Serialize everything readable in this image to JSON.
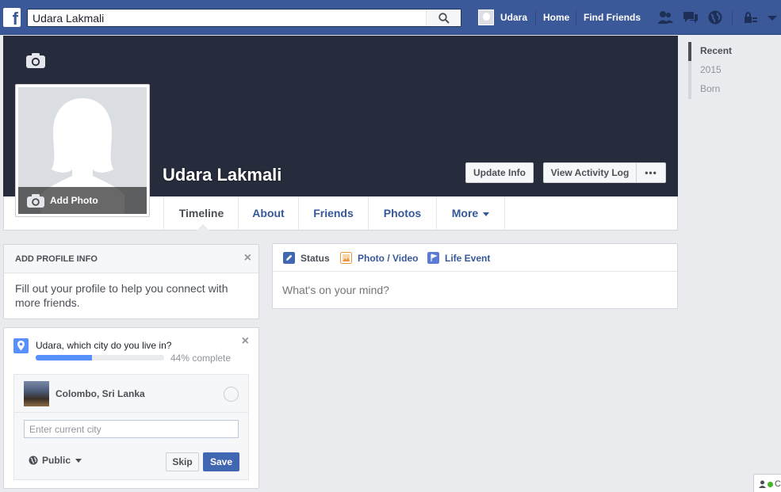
{
  "topbar": {
    "logo_letter": "f",
    "search_value": "Udara Lakmali",
    "user_name": "Udara",
    "home_label": "Home",
    "find_friends_label": "Find Friends"
  },
  "profile": {
    "name": "Udara Lakmali",
    "add_photo_label": "Add Photo",
    "update_info_label": "Update Info",
    "activity_log_label": "View Activity Log",
    "more_dots": "•••"
  },
  "tabs": [
    {
      "label": "Timeline"
    },
    {
      "label": "About"
    },
    {
      "label": "Friends"
    },
    {
      "label": "Photos"
    },
    {
      "label": "More"
    }
  ],
  "year_nav": [
    "Recent",
    "2015",
    "Born"
  ],
  "profile_info_card": {
    "header": "ADD PROFILE INFO",
    "close": "×",
    "body": "Fill out your profile to help you connect with more friends."
  },
  "city_card": {
    "question": "Udara, which city do you live in?",
    "progress_percent": 44,
    "progress_label": "44% complete",
    "close": "×",
    "suggested_city": "Colombo, Sri Lanka",
    "input_placeholder": "Enter current city",
    "privacy_label": "Public",
    "skip_label": "Skip",
    "save_label": "Save"
  },
  "composer": {
    "status_label": "Status",
    "photo_label": "Photo / Video",
    "life_event_label": "Life Event",
    "placeholder": "What's on your mind?"
  },
  "chat": {
    "label": "C"
  },
  "colors": {
    "brand_blue": "#3b5998",
    "link_blue": "#365899",
    "cover_dark": "#262c3c",
    "progress_blue": "#5890ff",
    "save_blue": "#4267b2"
  }
}
